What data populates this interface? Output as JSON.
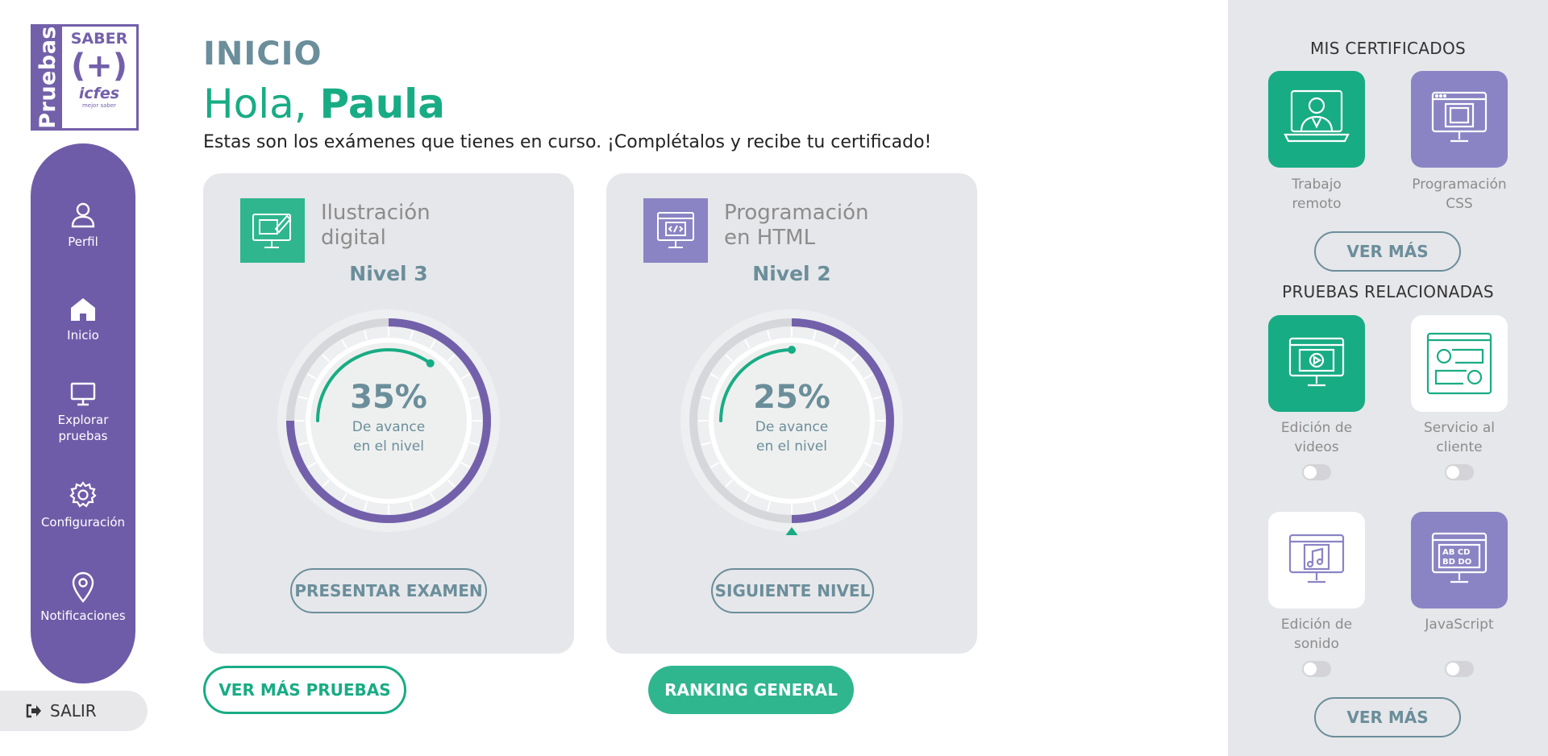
{
  "logo": {
    "vertical": "Pruebas",
    "saber": "SABER",
    "plus": "(+)",
    "icfes": "icfes",
    "tagline": "mejor saber"
  },
  "nav": {
    "items": [
      {
        "label": "Perfil",
        "icon": "user-icon"
      },
      {
        "label": "Inicio",
        "icon": "home-icon"
      },
      {
        "label": "Explorar pruebas",
        "icon": "monitor-icon"
      },
      {
        "label": "Configuración",
        "icon": "gear-icon"
      },
      {
        "label": "Notificaciones",
        "icon": "location-pin-icon"
      }
    ],
    "logout": "SALIR"
  },
  "header": {
    "title": "INICIO",
    "greeting": "Hola,",
    "name": "Paula",
    "subtitle": "Estas son los exámenes que tienes en curso. ¡Complétalos y recibe tu certificado!"
  },
  "courses": [
    {
      "title_line1": "Ilustración",
      "title_line2": "digital",
      "level": "Nivel 3",
      "progress": 0.35,
      "percent": "35%",
      "sub1": "De avance",
      "sub2": "en el nivel",
      "button": "PRESENTAR EXAMEN",
      "color": "#2fb68f"
    },
    {
      "title_line1": "Programación",
      "title_line2": "en HTML",
      "level": "Nivel 2",
      "progress": 0.25,
      "percent": "25%",
      "sub1": "De avance",
      "sub2": "en el nivel",
      "button": "SIGUIENTE NIVEL",
      "color": "#8a84c4"
    }
  ],
  "actions": {
    "more_tests": "VER MÁS PRUEBAS",
    "ranking": "RANKING GENERAL"
  },
  "right": {
    "certificates_title": "MIS CERTIFICADOS",
    "certificates": [
      {
        "line1": "Trabajo",
        "line2": "remoto",
        "icon": "remote-work-icon"
      },
      {
        "line1": "Programación",
        "line2": "CSS",
        "icon": "css-monitor-icon"
      }
    ],
    "certificates_more": "VER MÁS",
    "related_title": "PRUEBAS RELACIONADAS",
    "related": [
      {
        "line1": "Edición de",
        "line2": "videos",
        "icon": "video-editing-icon",
        "enabled": false
      },
      {
        "line1": "Servicio al",
        "line2": "cliente",
        "icon": "customer-service-icon",
        "enabled": false
      },
      {
        "line1": "Edición de",
        "line2": "sonido",
        "icon": "sound-editing-icon",
        "enabled": false
      },
      {
        "line1": "JavaScript",
        "line2": "",
        "icon": "javascript-icon",
        "enabled": false
      }
    ],
    "related_more": "VER MÁS"
  },
  "colors": {
    "purple": "#6f5ca8",
    "green": "#18ac84",
    "slate": "#6b8e9b",
    "panel": "#e6e7ea"
  }
}
